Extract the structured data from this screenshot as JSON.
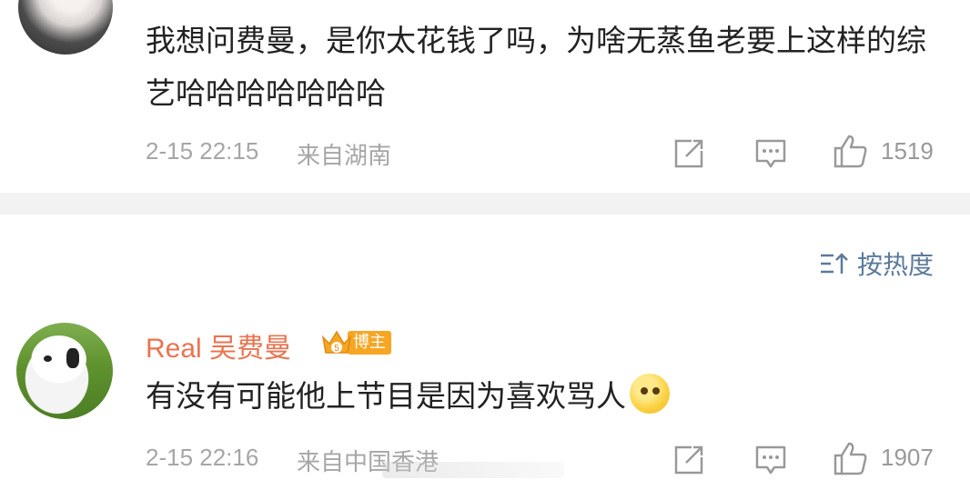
{
  "comments": [
    {
      "text": "我想问费曼，是你太花钱了吗，为啥无蒸鱼老要上这样的综艺哈哈哈哈哈哈哈",
      "time": "2-15 22:15",
      "location": "来自湖南",
      "likes": "1519"
    },
    {
      "username": "Real 吴费曼",
      "badge": "博主",
      "badge_level": "5",
      "text": "有没有可能他上节目是因为喜欢骂人",
      "time": "2-15 22:16",
      "location": "来自中国香港",
      "likes": "1907"
    }
  ],
  "sort": {
    "label": "按热度",
    "icon": "sort-icon"
  },
  "icons": [
    "share-icon",
    "comment-icon",
    "like-icon",
    "thinking-emoji"
  ],
  "colors": {
    "username": "#eb7350",
    "sort_link": "#5b7a9c",
    "meta_text": "#a6a6a6",
    "separator": "#f2f2f2",
    "badge": "#f6a623"
  }
}
